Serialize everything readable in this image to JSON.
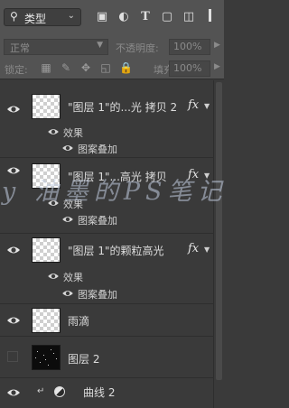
{
  "filter_bar": {
    "kind_label": "类型",
    "icons": [
      "image-filter-icon",
      "adjustment-filter-icon",
      "type-filter-icon",
      "shape-filter-icon",
      "smart-object-filter-icon"
    ]
  },
  "mode_bar": {
    "blend_mode": "正常",
    "opacity_label": "不透明度:",
    "opacity_value": "100%"
  },
  "lock_bar": {
    "lock_label": "锁定:",
    "fill_label": "填充:",
    "fill_value": "100%"
  },
  "layers": [
    {
      "name": "\"图层 1\"的...光 拷贝 2",
      "fx": "fx",
      "effects_label": "效果",
      "effect": "图案叠加"
    },
    {
      "name": "\"图层 1\"...高光 拷贝",
      "fx": "fx",
      "effects_label": "效果",
      "effect": "图案叠加"
    },
    {
      "name": "\"图层 1\"的颗粒高光",
      "fx": "fx",
      "effects_label": "效果",
      "effect": "图案叠加"
    },
    {
      "name": "雨滴"
    },
    {
      "name": "图层 2"
    },
    {
      "name": "曲线 2"
    }
  ],
  "watermark": {
    "text": "y 油墨的PS笔记"
  },
  "colors": {
    "panel": "#535353",
    "list_bg": "#3a3a3a",
    "text": "#d6d6d6"
  }
}
